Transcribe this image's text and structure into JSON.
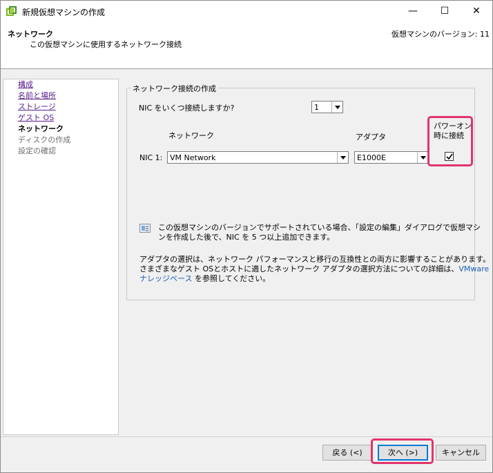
{
  "window": {
    "title": "新規仮想マシンの作成",
    "controls": {
      "minimize": "—",
      "maximize": "☐",
      "close": "✕"
    }
  },
  "header": {
    "title": "ネットワーク",
    "subtitle": "この仮想マシンに使用するネットワーク接続",
    "version": "仮想マシンのバージョン: 11"
  },
  "nav": {
    "items": [
      {
        "label": "構成",
        "state": "link"
      },
      {
        "label": "名前と場所",
        "state": "link"
      },
      {
        "label": "ストレージ",
        "state": "link"
      },
      {
        "label": "ゲスト OS",
        "state": "link"
      },
      {
        "label": "ネットワーク",
        "state": "current"
      },
      {
        "label": "ディスクの作成",
        "state": "disabled"
      },
      {
        "label": "設定の確認",
        "state": "disabled"
      }
    ]
  },
  "group": {
    "legend": "ネットワーク接続の作成",
    "nic_question": "NIC をいくつ接続しますか?",
    "nic_count": "1",
    "col_network": "ネットワーク",
    "col_adapter": "アダプタ",
    "col_power_line1": "パワーオン",
    "col_power_line2": "時に接続",
    "nic1_label": "NIC 1:",
    "nic1_network": "VM Network",
    "nic1_adapter": "E1000E",
    "nic1_connect_at_power_on": true,
    "info_line1": "この仮想マシンのバージョンでサポートされている場合、「設定の編集」ダイアログで仮想マシ",
    "info_line2": "ンを作成した後で、NIC を 5 つ以上追加できます。",
    "adapter_line1": "アダプタの選択は、ネットワーク パフォーマンスと移行の互換性との両方に影響することがあります。",
    "adapter_line2_text": "さまざまなゲスト OSとホストに適したネットワーク アダプタの選択方法についての詳細は、",
    "adapter_line2_link": "VMware",
    "adapter_line3_link": "ナレッジベース",
    "adapter_line3_text": "を参照してください。"
  },
  "footer": {
    "back": "戻る (<)",
    "next": "次へ (>)",
    "cancel": "キャンセル"
  },
  "colors": {
    "highlight": "#e2336b",
    "link": "#551a8b",
    "kb_link": "#1a5fb4",
    "accent": "#0078d7"
  },
  "icons": [
    "app-icon",
    "minimize-icon",
    "maximize-icon",
    "close-icon",
    "info-icon",
    "dropdown-arrow-icon",
    "checkmark-icon"
  ]
}
